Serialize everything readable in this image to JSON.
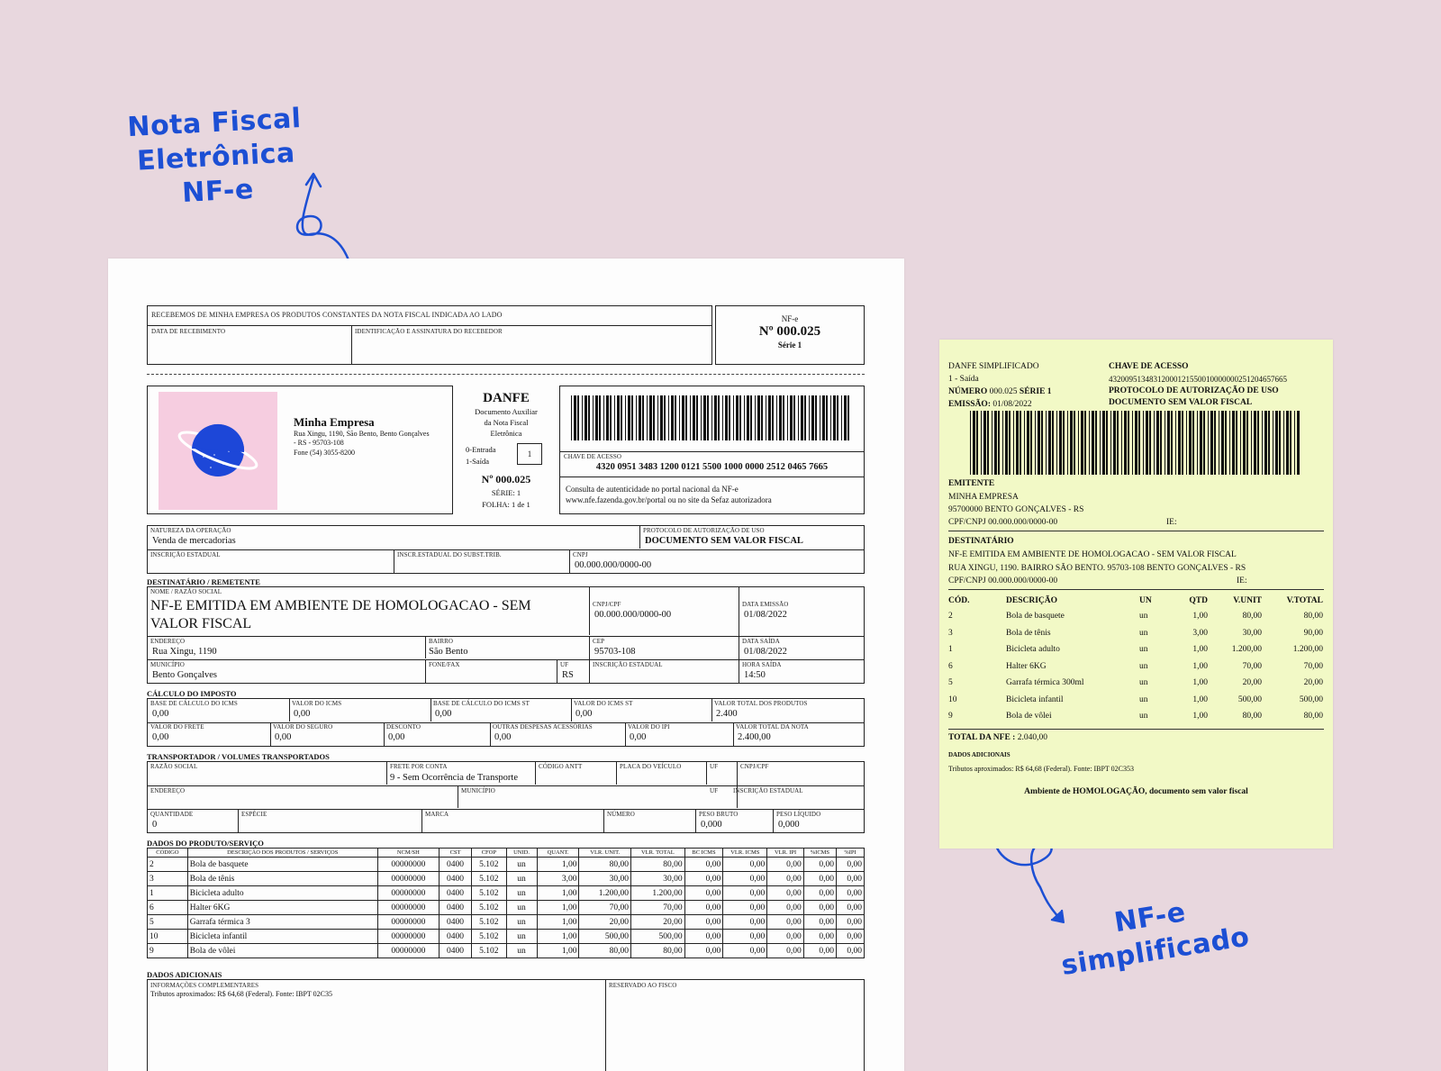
{
  "annotations": {
    "nfe_label": [
      "Nota Fiscal",
      "Eletrônica",
      "NF-e"
    ],
    "simplified_label": [
      "NF-e",
      "simplificado"
    ],
    "color": "#1c4fd4"
  },
  "danfe": {
    "canhoto": {
      "recebemos": "RECEBEMOS DE MINHA EMPRESA OS PRODUTOS CONSTANTES DA NOTA FISCAL INDICADA AO LADO",
      "data_recebimento": "DATA DE RECEBIMENTO",
      "identificacao": "IDENTIFICAÇÃO E ASSINATURA DO RECEBEDOR",
      "nfe": "NF-e",
      "numero": "Nº 000.025",
      "serie": "Série 1"
    },
    "emitente": {
      "nome": "Minha Empresa",
      "endereco1": "Rua Xingu, 1190, São Bento, Bento Gonçalves",
      "endereco2": "- RS - 95703-108",
      "fone": "Fone (54) 3055-8200"
    },
    "danfe_box": {
      "title": "DANFE",
      "doc1": "Documento Auxiliar",
      "doc2": "da Nota Fiscal",
      "doc3": "Eletrônica",
      "entrada": "0-Entrada",
      "saida": "1-Saída",
      "tipo": "1",
      "numero": "Nº 000.025",
      "serie": "SÉRIE: 1",
      "folha": "FOLHA: 1 de 1"
    },
    "chave": {
      "label": "CHAVE DE ACESSO",
      "valor": "4320 0951 3483 1200 0121 5500 1000 0000 2512 0465 7665",
      "consulta1": "Consulta de autenticidade no portal nacional da NF-e",
      "consulta2": "www.nfe.fazenda.gov.br/portal ou no site da Sefaz autorizadora"
    },
    "operacao": {
      "natureza_label": "NATUREZA DA OPERAÇÃO",
      "natureza": "Venda de mercadorias",
      "protocolo_label": "PROTOCOLO DE AUTORIZAÇÃO DE USO",
      "protocolo": "DOCUMENTO SEM VALOR FISCAL",
      "ie_label": "INSCRIÇÃO ESTADUAL",
      "ie_st_label": "INSCR.ESTADUAL DO SUBST.TRIB.",
      "cnpj_label": "CNPJ",
      "cnpj": "00.000.000/0000-00"
    },
    "destinatario": {
      "section": "DESTINATÁRIO / REMETENTE",
      "nome_label": "NOME / RAZÃO SOCIAL",
      "nome1": "NF-E EMITIDA EM AMBIENTE DE HOMOLOGACAO - SEM",
      "nome2": "VALOR FISCAL",
      "cnpj_label": "CNPJ/CPF",
      "cnpj": "00.000.000/0000-00",
      "data_emissao_label": "DATA EMISSÃO",
      "data_emissao": "01/08/2022",
      "endereco_label": "ENDEREÇO",
      "endereco": "Rua Xingu, 1190",
      "bairro_label": "BAIRRO",
      "bairro": "São Bento",
      "cep_label": "CEP",
      "cep": "95703-108",
      "data_saida_label": "DATA SAÍDA",
      "data_saida": "01/08/2022",
      "municipio_label": "MUNICÍPIO",
      "municipio": "Bento Gonçalves",
      "fone_label": "FONE/FAX",
      "uf_label": "UF",
      "uf": "RS",
      "ie_label": "INSCRIÇÃO ESTADUAL",
      "hora_label": "HORA SAÍDA",
      "hora": "14:50"
    },
    "imposto": {
      "section": "CÁLCULO DO IMPOSTO",
      "r1": [
        {
          "label": "BASE DE CÁLCULO DO ICMS",
          "value": "0,00"
        },
        {
          "label": "VALOR DO ICMS",
          "value": "0,00"
        },
        {
          "label": "BASE DE CÁLCULO DO ICMS ST",
          "value": "0,00"
        },
        {
          "label": "VALOR DO ICMS ST",
          "value": "0,00"
        },
        {
          "label": "VALOR TOTAL DOS PRODUTOS",
          "value": "2.400"
        }
      ],
      "r2": [
        {
          "label": "VALOR DO FRETE",
          "value": "0,00"
        },
        {
          "label": "VALOR DO SEGURO",
          "value": "0,00"
        },
        {
          "label": "DESCONTO",
          "value": "0,00"
        },
        {
          "label": "OUTRAS DESPESAS ACESSÓRIAS",
          "value": "0,00"
        },
        {
          "label": "VALOR DO IPI",
          "value": "0,00"
        },
        {
          "label": "VALOR TOTAL DA NOTA",
          "value": "2.400,00"
        }
      ]
    },
    "transporte": {
      "section": "TRANSPORTADOR / VOLUMES TRANSPORTADOS",
      "razao_label": "RAZÃO SOCIAL",
      "frete_label": "FRETE POR CONTA",
      "frete": "9 - Sem Ocorrência de Transporte",
      "antt_label": "CÓDIGO ANTT",
      "placa_label": "PLACA DO VEÍCULO",
      "uf_label": "UF",
      "cnpj_label": "CNPJ/CPF",
      "endereco_label": "ENDEREÇO",
      "municipio_label": "MUNICÍPIO",
      "uf2_label": "UF",
      "ie_label": "INSCRIÇÃO ESTADUAL",
      "quantidade_label": "QUANTIDADE",
      "quantidade": "0",
      "especie_label": "ESPÉCIE",
      "marca_label": "MARCA",
      "numero_label": "NÚMERO",
      "peso_bruto_label": "PESO BRUTO",
      "peso_bruto": "0,000",
      "peso_liquido_label": "PESO LÍQUIDO",
      "peso_liquido": "0,000"
    },
    "produtos": {
      "section": "DADOS DO PRODUTO/SERVIÇO",
      "headers": [
        "CÓDIGO",
        "DESCRIÇÃO DOS PRODUTOS / SERVIÇOS",
        "NCM/SH",
        "CST",
        "CFOP",
        "UNID.",
        "QUANT.",
        "VLR. UNIT.",
        "VLR. TOTAL",
        "BC ICMS",
        "VLR. ICMS",
        "VLR. IPI",
        "%ICMS",
        "%IPI"
      ],
      "rows": [
        [
          "2",
          "Bola de basquete",
          "00000000",
          "0400",
          "5.102",
          "un",
          "1,00",
          "80,00",
          "80,00",
          "0,00",
          "0,00",
          "0,00",
          "0,00",
          "0,00"
        ],
        [
          "3",
          "Bola de tênis",
          "00000000",
          "0400",
          "5.102",
          "un",
          "3,00",
          "30,00",
          "30,00",
          "0,00",
          "0,00",
          "0,00",
          "0,00",
          "0,00"
        ],
        [
          "1",
          "Bicicleta adulto",
          "00000000",
          "0400",
          "5.102",
          "un",
          "1,00",
          "1.200,00",
          "1.200,00",
          "0,00",
          "0,00",
          "0,00",
          "0,00",
          "0,00"
        ],
        [
          "6",
          "Halter 6KG",
          "00000000",
          "0400",
          "5.102",
          "un",
          "1,00",
          "70,00",
          "70,00",
          "0,00",
          "0,00",
          "0,00",
          "0,00",
          "0,00"
        ],
        [
          "5",
          "Garrafa térmica 3",
          "00000000",
          "0400",
          "5.102",
          "un",
          "1,00",
          "20,00",
          "20,00",
          "0,00",
          "0,00",
          "0,00",
          "0,00",
          "0,00"
        ],
        [
          "10",
          "Bicicleta infantil",
          "00000000",
          "0400",
          "5.102",
          "un",
          "1,00",
          "500,00",
          "500,00",
          "0,00",
          "0,00",
          "0,00",
          "0,00",
          "0,00"
        ],
        [
          "9",
          "Bola de vôlei",
          "00000000",
          "0400",
          "5.102",
          "un",
          "1,00",
          "80,00",
          "80,00",
          "0,00",
          "0,00",
          "0,00",
          "0,00",
          "0,00"
        ]
      ]
    },
    "adicionais": {
      "section": "DADOS ADICIONAIS",
      "info_label": "INFORMAÇÕES COMPLEMENTARES",
      "info": "Tributos aproximados: R$ 64,68 (Federal). Fonte: IBPT 02C35",
      "fisco_label": "RESERVADO AO FISCO"
    }
  },
  "simplificado": {
    "title": "DANFE SIMPLIFICADO",
    "tipo": "1 - Saída",
    "numero_label": "NÚMERO",
    "numero": "000.025",
    "serie": "SÉRIE 1",
    "emissao_label": "EMISSÃO:",
    "emissao": "01/08/2022",
    "chave_label": "CHAVE DE ACESSO",
    "chave": "43200951348312000121550010000000251204657665",
    "protocolo1": "PROTOCOLO DE AUTORIZAÇÃO DE USO",
    "protocolo2": "DOCUMENTO SEM VALOR FISCAL",
    "emitente_label": "EMITENTE",
    "emitente_nome": "MINHA EMPRESA",
    "emitente_cidade": "95700000 BENTO GONÇALVES - RS",
    "emitente_cnpj": "CPF/CNPJ 00.000.000/0000-00",
    "ie_label": "IE:",
    "destinatario_label": "DESTINATÁRIO",
    "dest_nome": "NF-E EMITIDA EM AMBIENTE DE HOMOLOGACAO - SEM VALOR FISCAL",
    "dest_endereco": "RUA XINGU, 1190. BAIRRO SÃO BENTO. 95703-108 BENTO GONÇALVES - RS",
    "dest_cnpj": "CPF/CNPJ 00.000.000/0000-00",
    "dest_ie": "IE:",
    "headers": [
      "CÓD.",
      "DESCRIÇÃO",
      "UN",
      "QTD",
      "V.UNIT",
      "V.TOTAL"
    ],
    "rows": [
      [
        "2",
        "Bola de basquete",
        "un",
        "1,00",
        "80,00",
        "80,00"
      ],
      [
        "3",
        "Bola de tênis",
        "un",
        "3,00",
        "30,00",
        "90,00"
      ],
      [
        "1",
        "Bicicleta adulto",
        "un",
        "1,00",
        "1.200,00",
        "1.200,00"
      ],
      [
        "6",
        "Halter 6KG",
        "un",
        "1,00",
        "70,00",
        "70,00"
      ],
      [
        "5",
        "Garrafa térmica 300ml",
        "un",
        "1,00",
        "20,00",
        "20,00"
      ],
      [
        "10",
        "Bicicleta infantil",
        "un",
        "1,00",
        "500,00",
        "500,00"
      ],
      [
        "9",
        "Bola de vôlei",
        "un",
        "1,00",
        "80,00",
        "80,00"
      ]
    ],
    "total_label": "TOTAL DA NFE :",
    "total": "2.040,00",
    "adicionais_label": "DADOS ADICIONAIS",
    "tributos": "Tributos aproximados: R$ 64,68   (Federal). Fonte: IBPT 02C353",
    "ambiente": "Ambiente de HOMOLOGAÇÃO, documento sem valor fiscal"
  }
}
